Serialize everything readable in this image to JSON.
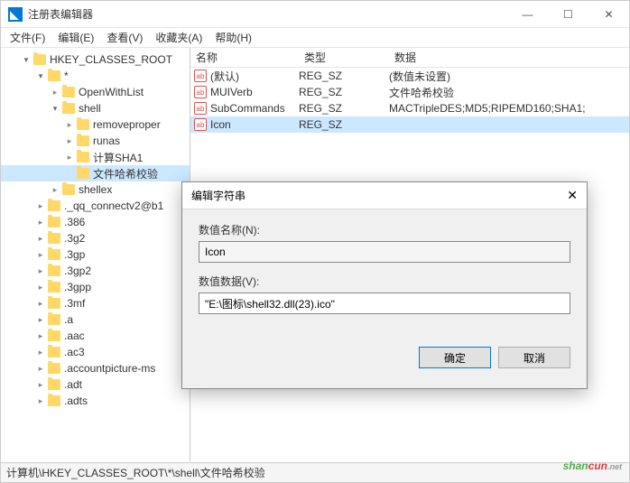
{
  "window": {
    "title": "注册表编辑器"
  },
  "menu": {
    "file": "文件(F)",
    "edit": "编辑(E)",
    "view": "查看(V)",
    "favorites": "收藏夹(A)",
    "help": "帮助(H)"
  },
  "tree": [
    {
      "indent": 1,
      "exp": "open",
      "label": "HKEY_CLASSES_ROOT"
    },
    {
      "indent": 2,
      "exp": "open",
      "label": "*"
    },
    {
      "indent": 3,
      "exp": "closed",
      "label": "OpenWithList"
    },
    {
      "indent": 3,
      "exp": "open",
      "label": "shell"
    },
    {
      "indent": 4,
      "exp": "closed",
      "label": "removeproper"
    },
    {
      "indent": 4,
      "exp": "closed",
      "label": "runas"
    },
    {
      "indent": 4,
      "exp": "closed",
      "label": "计算SHA1"
    },
    {
      "indent": 4,
      "exp": "none",
      "label": "文件哈希校验",
      "selected": true
    },
    {
      "indent": 3,
      "exp": "closed",
      "label": "shellex"
    },
    {
      "indent": 2,
      "exp": "closed",
      "label": "._qq_connectv2@b1"
    },
    {
      "indent": 2,
      "exp": "closed",
      "label": ".386"
    },
    {
      "indent": 2,
      "exp": "closed",
      "label": ".3g2"
    },
    {
      "indent": 2,
      "exp": "closed",
      "label": ".3gp"
    },
    {
      "indent": 2,
      "exp": "closed",
      "label": ".3gp2"
    },
    {
      "indent": 2,
      "exp": "closed",
      "label": ".3gpp"
    },
    {
      "indent": 2,
      "exp": "closed",
      "label": ".3mf"
    },
    {
      "indent": 2,
      "exp": "closed",
      "label": ".a"
    },
    {
      "indent": 2,
      "exp": "closed",
      "label": ".aac"
    },
    {
      "indent": 2,
      "exp": "closed",
      "label": ".ac3"
    },
    {
      "indent": 2,
      "exp": "closed",
      "label": ".accountpicture-ms"
    },
    {
      "indent": 2,
      "exp": "closed",
      "label": ".adt"
    },
    {
      "indent": 2,
      "exp": "closed",
      "label": ".adts"
    }
  ],
  "list": {
    "headers": {
      "name": "名称",
      "type": "类型",
      "data": "数据"
    },
    "rows": [
      {
        "name": "(默认)",
        "type": "REG_SZ",
        "data": "(数值未设置)"
      },
      {
        "name": "MUIVerb",
        "type": "REG_SZ",
        "data": "文件哈希校验"
      },
      {
        "name": "SubCommands",
        "type": "REG_SZ",
        "data": "MACTripleDES;MD5;RIPEMD160;SHA1;"
      },
      {
        "name": "Icon",
        "type": "REG_SZ",
        "data": "",
        "selected": true
      }
    ]
  },
  "dialog": {
    "title": "编辑字符串",
    "name_label": "数值名称(N):",
    "name_value": "Icon",
    "data_label": "数值数据(V):",
    "data_value": "\"E:\\图标\\shell32.dll(23).ico\"",
    "ok": "确定",
    "cancel": "取消"
  },
  "statusbar": {
    "path": "计算机\\HKEY_CLASSES_ROOT\\*\\shell\\文件哈希校验"
  },
  "watermark": {
    "text1": "shan",
    "text2": "cun",
    "sub": ".net",
    "alt": "山村网"
  }
}
